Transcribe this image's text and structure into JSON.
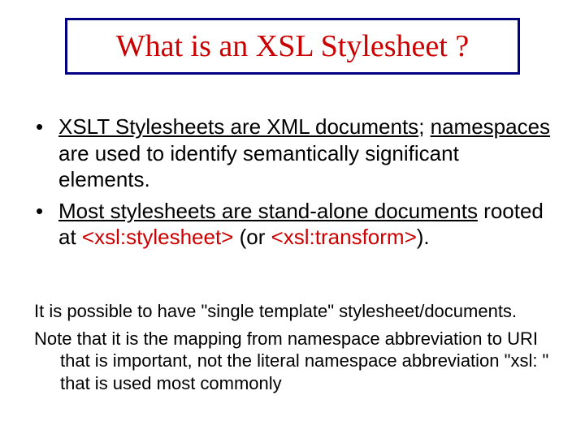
{
  "title": "What is an XSL Stylesheet ?",
  "bullets": [
    {
      "part1_underlined": "XSLT Stylesheets are XML documents",
      "semicolon": "; ",
      "part2_underlined": "namespaces",
      "part2_rest": " are used to identify semantically significant elements."
    },
    {
      "part1_underlined": "Most stylesheets are stand-alone documents",
      "part2_pre": " rooted at ",
      "code1": "<xsl:stylesheet>",
      "mid": " (or ",
      "code2": "<xsl:transform>",
      "end": ")."
    }
  ],
  "notes": [
    "It is possible to have \"single template\" stylesheet/documents.",
    "Note that it is the mapping from namespace abbreviation to URI that is important, not the literal namespace abbreviation \"xsl: \" that is used most commonly"
  ]
}
